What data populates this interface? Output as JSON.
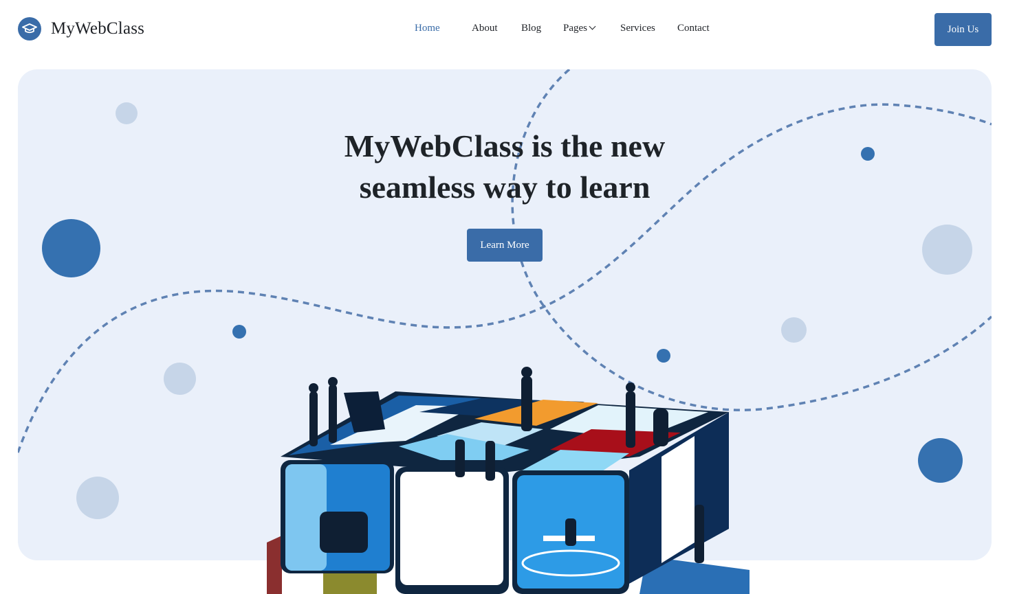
{
  "brand": {
    "name": "MyWebClass",
    "logo_icon": "graduation-cap-icon"
  },
  "nav": {
    "items": [
      {
        "label": "Home",
        "active": true
      },
      {
        "label": "About",
        "active": false
      },
      {
        "label": "Blog",
        "active": false
      },
      {
        "label": "Pages",
        "active": false,
        "has_dropdown": true
      },
      {
        "label": "Services",
        "active": false
      },
      {
        "label": "Contact",
        "active": false
      }
    ],
    "join_label": "Join Us"
  },
  "hero": {
    "title_line1": "MyWebClass is the new",
    "title_line2": "seamless way to learn",
    "cta_label": "Learn More",
    "illustration_icon": "rubiks-cube-office-illustration"
  },
  "colors": {
    "accent": "#3a6ca8",
    "hero_background": "#eaf0fa",
    "dot_light": "#c6d5e8",
    "dot_dark": "#3571b0",
    "dashed_line": "#5f82b3"
  }
}
